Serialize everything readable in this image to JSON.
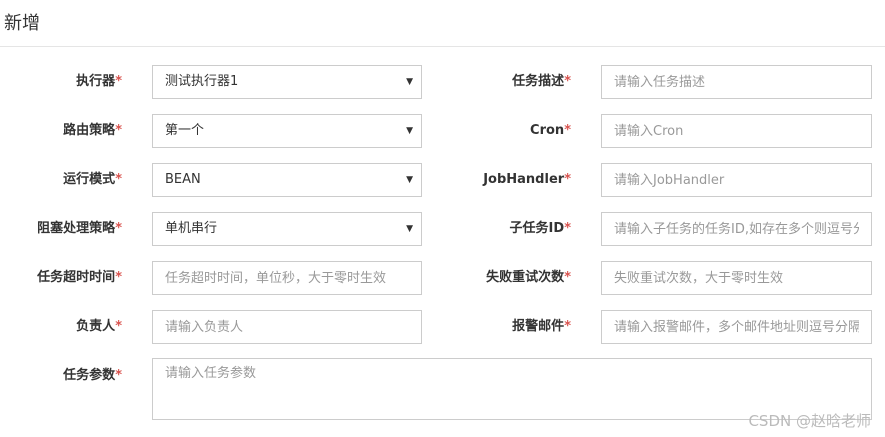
{
  "header": {
    "title": "新增"
  },
  "form": {
    "rows": [
      {
        "left": {
          "label": "执行器",
          "required": "*",
          "type": "select",
          "value": "测试执行器1"
        },
        "right": {
          "label": "任务描述",
          "required": "*",
          "type": "input",
          "placeholder": "请输入任务描述"
        }
      },
      {
        "left": {
          "label": "路由策略",
          "required": "*",
          "type": "select",
          "value": "第一个"
        },
        "right": {
          "label": "Cron",
          "required": "*",
          "type": "input",
          "placeholder": "请输入Cron"
        }
      },
      {
        "left": {
          "label": "运行模式",
          "required": "*",
          "type": "select",
          "value": "BEAN"
        },
        "right": {
          "label": "JobHandler",
          "required": "*",
          "type": "input",
          "placeholder": "请输入JobHandler"
        }
      },
      {
        "left": {
          "label": "阻塞处理策略",
          "required": "*",
          "type": "select",
          "value": "单机串行"
        },
        "right": {
          "label": "子任务ID",
          "required": "*",
          "type": "input",
          "placeholder": "请输入子任务的任务ID,如存在多个则逗号分隔"
        }
      },
      {
        "left": {
          "label": "任务超时时间",
          "required": "*",
          "type": "input",
          "placeholder": "任务超时时间，单位秒，大于零时生效"
        },
        "right": {
          "label": "失败重试次数",
          "required": "*",
          "type": "input",
          "placeholder": "失败重试次数，大于零时生效"
        }
      },
      {
        "left": {
          "label": "负责人",
          "required": "*",
          "type": "input",
          "placeholder": "请输入负责人"
        },
        "right": {
          "label": "报警邮件",
          "required": "*",
          "type": "input",
          "placeholder": "请输入报警邮件，多个邮件地址则逗号分隔"
        }
      }
    ],
    "param": {
      "label": "任务参数",
      "required": "*",
      "placeholder": "请输入任务参数"
    }
  },
  "icons": {
    "select_caret": "caret-down-icon",
    "caret_glyph": "▼"
  },
  "colors": {
    "required": "#d9534f",
    "border": "#cccccc",
    "placeholder": "#999999"
  },
  "watermark": "CSDN @赵晗老师"
}
